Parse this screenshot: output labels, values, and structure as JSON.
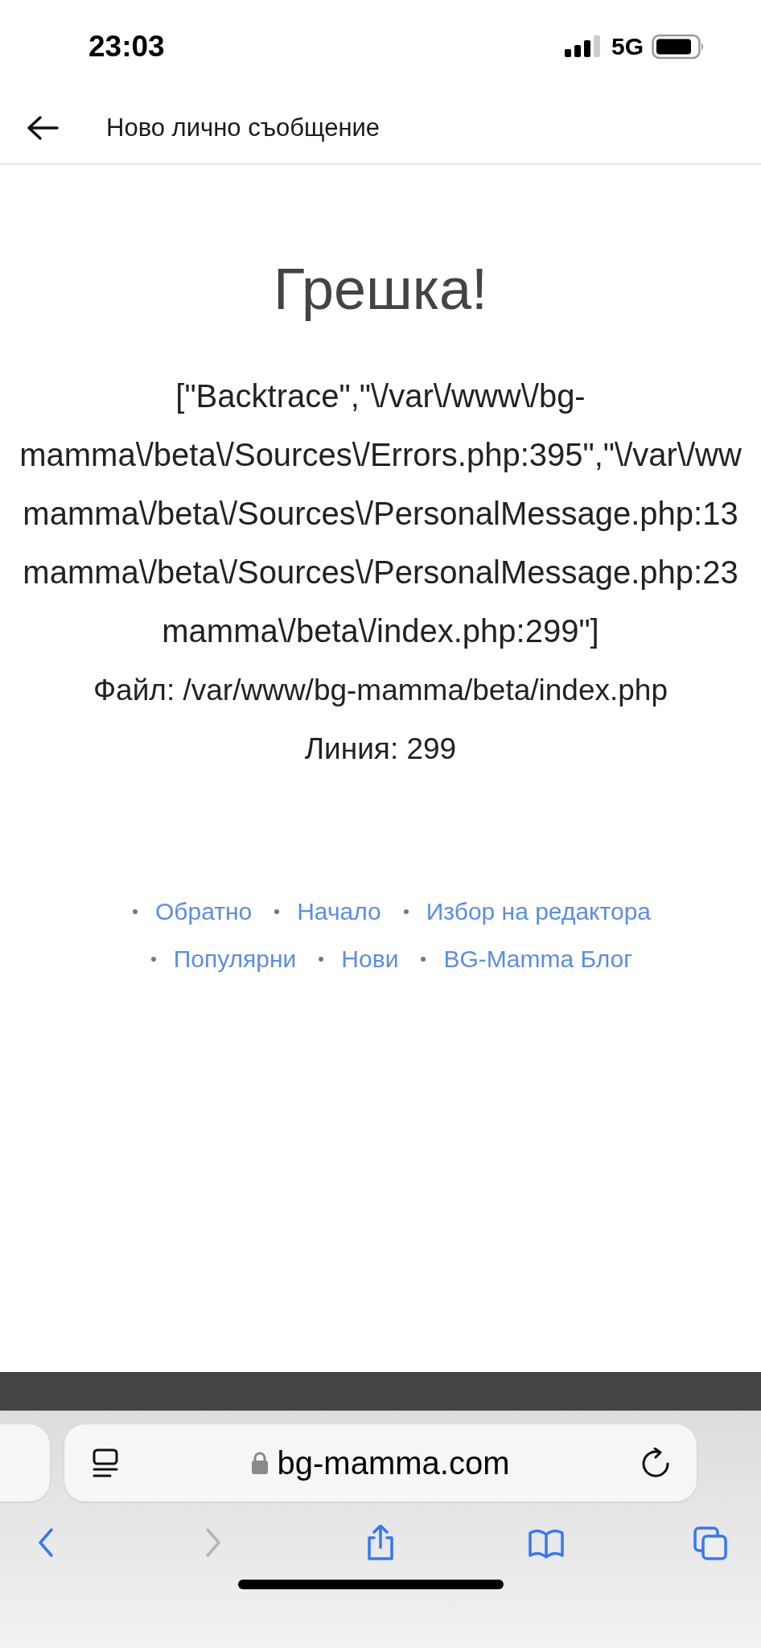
{
  "status_bar": {
    "time": "23:03",
    "network": "5G"
  },
  "header": {
    "title": "Ново лично съобщение"
  },
  "error": {
    "heading": "Грешка!",
    "lines": [
      "[\"Backtrace\",\"\\/var\\/www\\/bg-",
      "mamma\\/beta\\/Sources\\/Errors.php:395\",\"\\/var\\/ww",
      "mamma\\/beta\\/Sources\\/PersonalMessage.php:13",
      "mamma\\/beta\\/Sources\\/PersonalMessage.php:23",
      "mamma\\/beta\\/index.php:299\"]"
    ],
    "file": "Файл: /var/www/bg-mamma/beta/index.php",
    "line": "Линия: 299"
  },
  "footer_links": [
    [
      "Обратно",
      "Начало",
      "Избор на редактора"
    ],
    [
      "Популярни",
      "Нови",
      "BG-Mamma Блог"
    ]
  ],
  "browser": {
    "url": "bg-mamma.com",
    "toolbar": [
      {
        "kind": "back",
        "disabled": false
      },
      {
        "kind": "forward",
        "disabled": true
      },
      {
        "kind": "share",
        "disabled": false
      },
      {
        "kind": "bookmarks",
        "disabled": false
      },
      {
        "kind": "tabs",
        "disabled": false
      }
    ]
  }
}
